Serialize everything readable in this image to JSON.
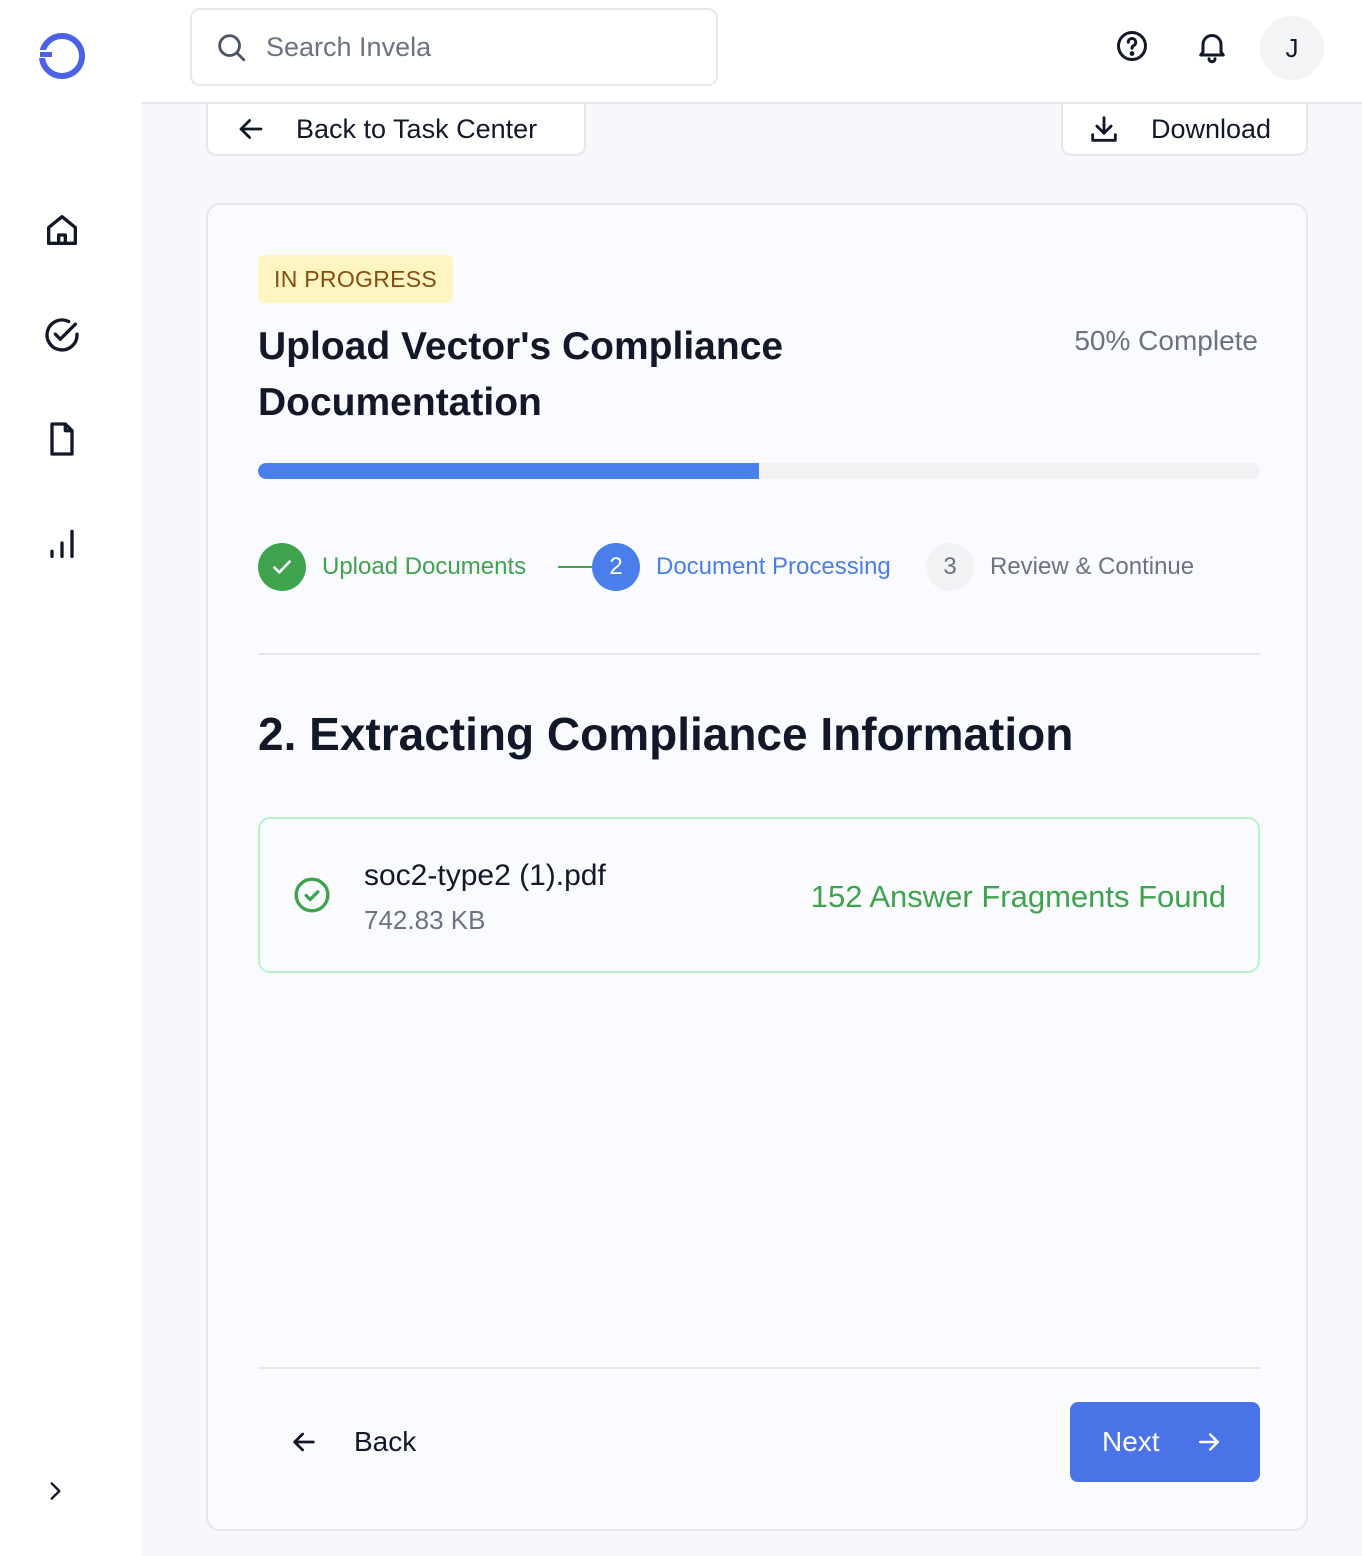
{
  "app": {
    "logo_icon": "app-logo-ring",
    "accent_color": "#4a73e8"
  },
  "sidebar": {
    "items": [
      {
        "icon": "home-icon"
      },
      {
        "icon": "task-check-icon"
      },
      {
        "icon": "file-icon"
      },
      {
        "icon": "bar-chart-icon"
      }
    ],
    "expand_icon": "chevron-right-icon"
  },
  "header": {
    "search": {
      "placeholder": "Search Invela",
      "value": ""
    },
    "help_icon": "help-circle-icon",
    "notifications_icon": "bell-icon",
    "avatar_initial": "J"
  },
  "toolbar": {
    "back_to_task_center": "Back to Task Center",
    "download": "Download"
  },
  "task": {
    "status": "IN PROGRESS",
    "status_color": "#fef5c3",
    "title": "Upload Vector's Compliance Documentation",
    "progress_label": "50% Complete",
    "progress_percent": 50
  },
  "stepper": {
    "steps": [
      {
        "number": "1",
        "label": "Upload Documents",
        "state": "complete"
      },
      {
        "number": "2",
        "label": "Document Processing",
        "state": "active"
      },
      {
        "number": "3",
        "label": "Review & Continue",
        "state": "upcoming"
      }
    ]
  },
  "section": {
    "title": "2. Extracting Compliance Information"
  },
  "file": {
    "name": "soc2-type2 (1).pdf",
    "size": "742.83 KB",
    "result": "152 Answer Fragments Found",
    "status_icon": "check-circle-icon"
  },
  "footer": {
    "back_label": "Back",
    "next_label": "Next"
  }
}
